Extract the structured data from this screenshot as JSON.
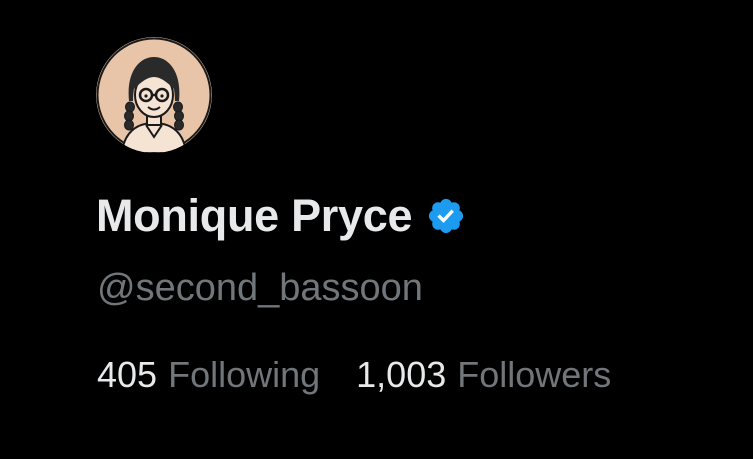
{
  "profile": {
    "display_name": "Monique Pryce",
    "handle": "@second_bassoon",
    "verified": true,
    "avatar_icon": "illustrated-woman-with-glasses-and-braids"
  },
  "stats": {
    "following_count": "405",
    "following_label": "Following",
    "followers_count": "1,003",
    "followers_label": "Followers"
  },
  "colors": {
    "background": "#000000",
    "primary_text": "#e7e9ea",
    "secondary_text": "#71767b",
    "verified_blue": "#1d9bf0",
    "avatar_bg": "#e8c4a8"
  }
}
